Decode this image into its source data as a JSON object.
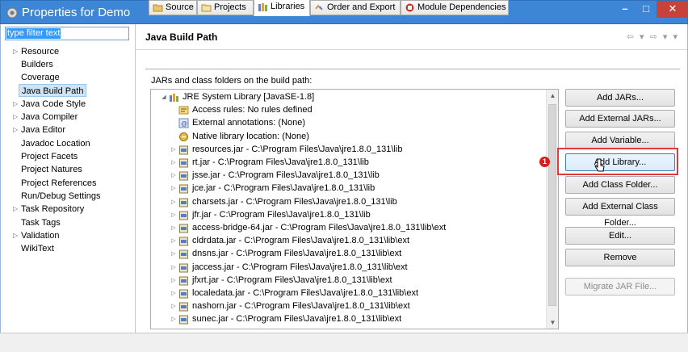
{
  "window": {
    "title": "Properties for Demo",
    "app_icon": "properties-icon",
    "minimize_glyph": "–",
    "maximize_glyph": "□",
    "close_glyph": "✕"
  },
  "filter": {
    "value": "type filter text"
  },
  "nav": {
    "items": [
      {
        "label": "Resource",
        "expandable": true
      },
      {
        "label": "Builders",
        "expandable": false
      },
      {
        "label": "Coverage",
        "expandable": false
      },
      {
        "label": "Java Build Path",
        "expandable": false,
        "selected": true
      },
      {
        "label": "Java Code Style",
        "expandable": true
      },
      {
        "label": "Java Compiler",
        "expandable": true
      },
      {
        "label": "Java Editor",
        "expandable": true
      },
      {
        "label": "Javadoc Location",
        "expandable": false
      },
      {
        "label": "Project Facets",
        "expandable": false
      },
      {
        "label": "Project Natures",
        "expandable": false
      },
      {
        "label": "Project References",
        "expandable": false
      },
      {
        "label": "Run/Debug Settings",
        "expandable": false
      },
      {
        "label": "Task Repository",
        "expandable": true
      },
      {
        "label": "Task Tags",
        "expandable": false
      },
      {
        "label": "Validation",
        "expandable": true
      },
      {
        "label": "WikiText",
        "expandable": false
      }
    ]
  },
  "header": {
    "title": "Java Build Path",
    "nav_arrows": "⇦ ▾ ⇨ ▾ ▾"
  },
  "tabs": [
    {
      "label": "Source",
      "icon": "source-folder-icon"
    },
    {
      "label": "Projects",
      "icon": "projects-icon"
    },
    {
      "label": "Libraries",
      "icon": "libraries-icon",
      "active": true
    },
    {
      "label": "Order and Export",
      "icon": "order-export-icon"
    },
    {
      "label": "Module Dependencies",
      "icon": "module-dependencies-icon"
    }
  ],
  "panel": {
    "subtitle": "JARs and class folders on the build path:"
  },
  "tree": {
    "root": {
      "label": "JRE System Library [JavaSE-1.8]",
      "icon": "library-icon",
      "expanded": true
    },
    "root_children": [
      {
        "label": "Access rules: No rules defined",
        "icon": "access-rules-icon"
      },
      {
        "label": "External annotations: (None)",
        "icon": "annotations-icon"
      },
      {
        "label": "Native library location: (None)",
        "icon": "native-library-icon"
      }
    ],
    "jars": [
      "resources.jar - C:\\Program Files\\Java\\jre1.8.0_131\\lib",
      "rt.jar - C:\\Program Files\\Java\\jre1.8.0_131\\lib",
      "jsse.jar - C:\\Program Files\\Java\\jre1.8.0_131\\lib",
      "jce.jar - C:\\Program Files\\Java\\jre1.8.0_131\\lib",
      "charsets.jar - C:\\Program Files\\Java\\jre1.8.0_131\\lib",
      "jfr.jar - C:\\Program Files\\Java\\jre1.8.0_131\\lib",
      "access-bridge-64.jar - C:\\Program Files\\Java\\jre1.8.0_131\\lib\\ext",
      "cldrdata.jar - C:\\Program Files\\Java\\jre1.8.0_131\\lib\\ext",
      "dnsns.jar - C:\\Program Files\\Java\\jre1.8.0_131\\lib\\ext",
      "jaccess.jar - C:\\Program Files\\Java\\jre1.8.0_131\\lib\\ext",
      "jfxrt.jar - C:\\Program Files\\Java\\jre1.8.0_131\\lib\\ext",
      "localedata.jar - C:\\Program Files\\Java\\jre1.8.0_131\\lib\\ext",
      "nashorn.jar - C:\\Program Files\\Java\\jre1.8.0_131\\lib\\ext",
      "sunec.jar - C:\\Program Files\\Java\\jre1.8.0_131\\lib\\ext"
    ]
  },
  "buttons": {
    "add_jars": "Add JARs...",
    "add_external_jars": "Add External JARs...",
    "add_variable": "Add Variable...",
    "add_library": "Add Library...",
    "add_class_folder": "Add Class Folder...",
    "add_external_class_folder": "Add External Class Folder...",
    "edit": "Edit...",
    "remove": "Remove",
    "migrate_jar": "Migrate JAR File..."
  },
  "annotation": {
    "badge": "1"
  },
  "colors": {
    "titlebar": "#3c86d5",
    "close": "#c7423a",
    "highlight": "#e23a3a",
    "selection": "#3399ff"
  }
}
